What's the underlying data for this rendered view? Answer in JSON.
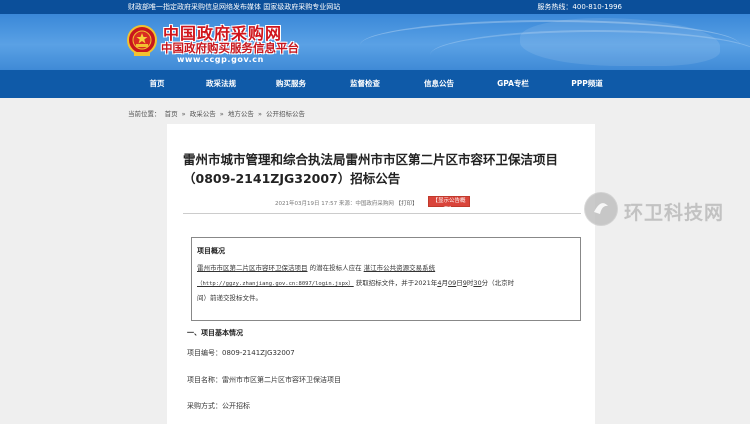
{
  "topbar": {
    "notice": "财政部唯一指定政府采购信息网络发布媒体  国家级政府采购专业网站",
    "hotline": "服务热线：400-810-1996"
  },
  "header": {
    "site_name": "中国政府采购网",
    "site_subtitle": "中国政府购买服务信息平台",
    "site_url": "www.ccgp.gov.cn"
  },
  "nav": {
    "items": [
      "首页",
      "政采法规",
      "购买服务",
      "监督检查",
      "信息公告",
      "GPA专栏",
      "PPP频道"
    ]
  },
  "breadcrumb": {
    "label": "当前位置：",
    "items": [
      "首页",
      "政采公告",
      "地方公告",
      "公开招标公告"
    ],
    "separator": "»"
  },
  "article": {
    "title": "雷州市城市管理和综合执法局雷州市市区第二片区市容环卫保洁项目（0809-2141ZJG32007）招标公告",
    "date": "2021年03月19日 17:57",
    "source_label": "来源：",
    "source": "中国政府采购网",
    "print_label": "【打印】",
    "show_tag_button": "【显示公告概要】",
    "overview": {
      "heading": "项目概况",
      "line1_project": "雷州市市区第二片区市容环卫保洁项目",
      "line1_mid": " 的潜在投标人应在 ",
      "line1_system": "湛江市公共资源交易系统",
      "line2_url": "（http://ggzy.zhanjiang.gov.cn:8097/login.jspx）",
      "line2_mid": " 获取招标文件，并于2021年",
      "line2_month": "4",
      "line2_m": "月",
      "line2_day": "09",
      "line2_d": "日",
      "line2_hour": "9",
      "line2_h": "时",
      "line2_min": "30",
      "line2_end": "分（北京时",
      "line3": "间）前递交投标文件。"
    },
    "section1_heading": "一、项目基本情况",
    "project_number_label": "项目编号：",
    "project_number": "0809-2141ZJG32007",
    "project_name_label": "项目名称：",
    "project_name": "雷州市市区第二片区市容环卫保洁项目",
    "procurement_method_label": "采购方式：",
    "procurement_method": "公开招标"
  },
  "watermark": {
    "text": "环卫科技网"
  },
  "colors": {
    "topbar": "#0b4f9a",
    "nav": "#0f5aa8",
    "logo_red": "#d0141b",
    "tag_button": "#d9443a"
  }
}
